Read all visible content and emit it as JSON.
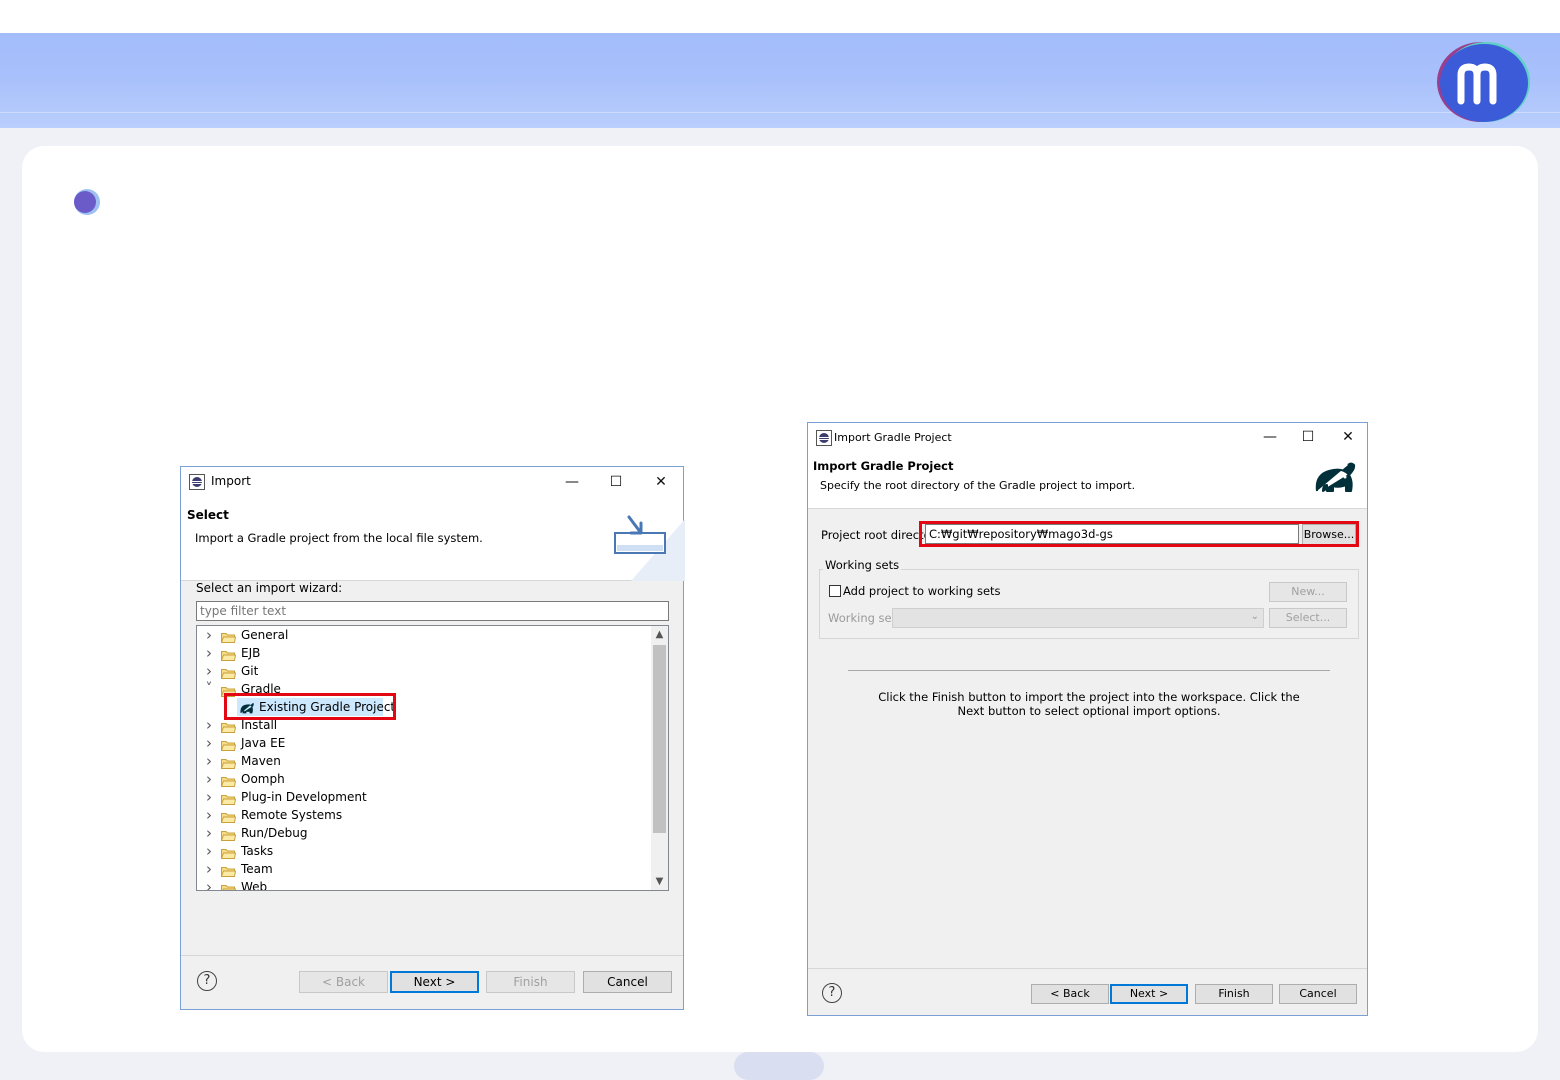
{
  "slide": {
    "brand_colors": {
      "banner": "#a8c0fb",
      "logo_primary": "#3d5fd9",
      "logo_accent": "#8e3d8c",
      "highlight": "#e30613"
    }
  },
  "import_dialog": {
    "title": "Import",
    "header_title": "Select",
    "header_desc": "Import a Gradle project from the local file system.",
    "wizard_label": "Select an import wizard:",
    "filter_placeholder": "type filter text",
    "tree": [
      {
        "label": "General",
        "expanded": false
      },
      {
        "label": "EJB",
        "expanded": false
      },
      {
        "label": "Git",
        "expanded": false
      },
      {
        "label": "Gradle",
        "expanded": true
      },
      {
        "label": "Existing Gradle Project",
        "child": true,
        "selected": true
      },
      {
        "label": "Install",
        "expanded": false
      },
      {
        "label": "Java EE",
        "expanded": false
      },
      {
        "label": "Maven",
        "expanded": false
      },
      {
        "label": "Oomph",
        "expanded": false
      },
      {
        "label": "Plug-in Development",
        "expanded": false
      },
      {
        "label": "Remote Systems",
        "expanded": false
      },
      {
        "label": "Run/Debug",
        "expanded": false
      },
      {
        "label": "Tasks",
        "expanded": false
      },
      {
        "label": "Team",
        "expanded": false
      },
      {
        "label": "Web",
        "expanded": false
      }
    ],
    "buttons": {
      "back": "< Back",
      "next": "Next >",
      "finish": "Finish",
      "cancel": "Cancel"
    }
  },
  "gradle_dialog": {
    "title": "Import Gradle Project",
    "header_title": "Import Gradle Project",
    "header_desc": "Specify the root directory of the Gradle project to import.",
    "root_dir_label": "Project root directory",
    "root_dir_value": "C:₩git₩repository₩mago3d-gs",
    "browse_label": "Browse...",
    "working_sets_group": "Working sets",
    "add_to_working_sets": "Add project to working sets",
    "new_label": "New...",
    "working_sets_label": "Working sets",
    "select_label": "Select...",
    "info_line1": "Click the Finish button to import the project into the workspace. Click the",
    "info_line2": "Next button to select optional import options.",
    "buttons": {
      "back": "< Back",
      "next": "Next >",
      "finish": "Finish",
      "cancel": "Cancel"
    }
  }
}
